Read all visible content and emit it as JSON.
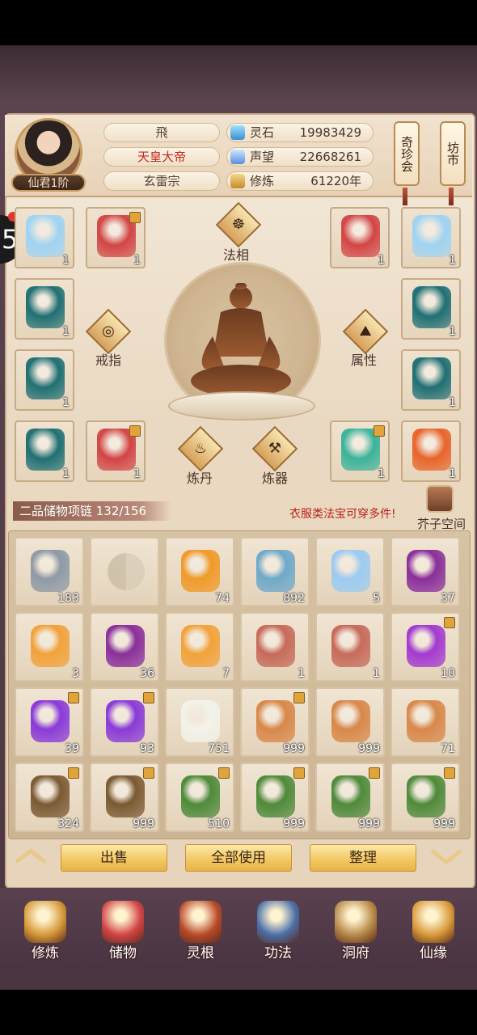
{
  "character": {
    "rank_badge": "仙君1阶",
    "name": "飛",
    "title": "天皇大帝",
    "sect": "玄雷宗"
  },
  "stats": [
    {
      "label": "灵石",
      "value": "19983429",
      "icon": "spirit-stone-icon"
    },
    {
      "label": "声望",
      "value": "22668261",
      "icon": "prestige-crystal-icon"
    },
    {
      "label": "修炼",
      "value": "61220年",
      "icon": "cultivation-icon"
    }
  ],
  "side_buttons": {
    "treasure_fair": "奇珍会",
    "market": "坊市"
  },
  "edge_badge": "5",
  "equipment": {
    "slots": [
      {
        "icon": "dragon-armor-icon",
        "count": "1",
        "locked": false,
        "color": "#9fd3f2"
      },
      {
        "icon": "red-robe-icon",
        "count": "1",
        "locked": true,
        "color": "#d24545"
      },
      {
        "icon": "red-robe-icon",
        "count": "1",
        "locked": false,
        "color": "#d24545"
      },
      {
        "icon": "dragon-armor-icon",
        "count": "1",
        "locked": false,
        "color": "#9fd3f2"
      },
      {
        "icon": "teal-robe-icon",
        "count": "1",
        "locked": false,
        "color": "#1f6f73"
      },
      {
        "icon": "teal-robe-icon",
        "count": "1",
        "locked": false,
        "color": "#1f6f73"
      },
      {
        "icon": "teal-robe-icon",
        "count": "1",
        "locked": false,
        "color": "#1f6f73"
      },
      {
        "icon": "teal-robe-icon",
        "count": "1",
        "locked": false,
        "color": "#1f6f73"
      },
      {
        "icon": "teal-robe-icon",
        "count": "1",
        "locked": false,
        "color": "#1f6f73"
      },
      {
        "icon": "red-robe-icon",
        "count": "1",
        "locked": true,
        "color": "#d24545"
      },
      {
        "icon": "jade-armor-icon",
        "count": "1",
        "locked": true,
        "color": "#3bb39a"
      },
      {
        "icon": "flame-armor-icon",
        "count": "1",
        "locked": false,
        "color": "#e8642a"
      }
    ],
    "labels": {
      "dharma_form": "法相",
      "ring": "戒指",
      "attribute": "属性",
      "alchemy": "炼丹",
      "forging": "炼器"
    }
  },
  "inventory": {
    "banner": "二品储物项链 132/156",
    "hint": "衣服类法宝可穿多件!",
    "space_label": "芥子空间",
    "items": [
      {
        "icon": "silver-ore-icon",
        "count": "183",
        "locked": false,
        "color": "#8f9aa6"
      },
      {
        "icon": "empty-taiji-icon",
        "count": "",
        "locked": false,
        "color": ""
      },
      {
        "icon": "gold-ingot-icon",
        "count": "74",
        "locked": false,
        "color": "#f09a2a"
      },
      {
        "icon": "blue-orb-icon",
        "count": "892",
        "locked": false,
        "color": "#6fa9c8"
      },
      {
        "icon": "ice-orb-icon",
        "count": "5",
        "locked": false,
        "color": "#9ccbf0"
      },
      {
        "icon": "purple-flame-icon",
        "count": "37",
        "locked": false,
        "color": "#8a2f9a"
      },
      {
        "icon": "orange-flame-icon",
        "count": "3",
        "locked": false,
        "color": "#f2a23a"
      },
      {
        "icon": "purple-flame-icon",
        "count": "36",
        "locked": false,
        "color": "#8a2f9a"
      },
      {
        "icon": "orange-flame-icon",
        "count": "7",
        "locked": false,
        "color": "#f2a23a"
      },
      {
        "icon": "treasure-box-icon",
        "count": "1",
        "locked": false,
        "color": "#c76a5a"
      },
      {
        "icon": "treasure-box-icon",
        "count": "1",
        "locked": false,
        "color": "#c76a5a"
      },
      {
        "icon": "purple-pearl-icon",
        "count": "10",
        "locked": true,
        "color": "#a43ad0"
      },
      {
        "icon": "crystal-ball-icon",
        "count": "39",
        "locked": true,
        "color": "#8a3ad8"
      },
      {
        "icon": "crystal-ball-icon",
        "count": "93",
        "locked": true,
        "color": "#8a3ad8"
      },
      {
        "icon": "white-lily-icon",
        "count": "751",
        "locked": false,
        "color": "#f3f3ea"
      },
      {
        "icon": "ginseng-icon",
        "count": "999",
        "locked": true,
        "color": "#d8884a"
      },
      {
        "icon": "ginseng-icon",
        "count": "999",
        "locked": false,
        "color": "#d8884a"
      },
      {
        "icon": "ginseng-icon",
        "count": "71",
        "locked": false,
        "color": "#d8884a"
      },
      {
        "icon": "root-herb-icon",
        "count": "324",
        "locked": true,
        "color": "#7a5a32"
      },
      {
        "icon": "root-herb-icon",
        "count": "999",
        "locked": true,
        "color": "#7a5a32"
      },
      {
        "icon": "flower-herb-icon",
        "count": "510",
        "locked": true,
        "color": "#4f8a3a"
      },
      {
        "icon": "flower-herb-icon",
        "count": "999",
        "locked": true,
        "color": "#4f8a3a"
      },
      {
        "icon": "flower-herb-icon",
        "count": "999",
        "locked": true,
        "color": "#4f8a3a"
      },
      {
        "icon": "flower-herb-icon",
        "count": "999",
        "locked": true,
        "color": "#4f8a3a"
      }
    ]
  },
  "actions": {
    "sell": "出售",
    "use_all": "全部使用",
    "organize": "整理"
  },
  "nav": [
    {
      "label": "修炼",
      "icon": "cultivation-nav-icon",
      "color": "#d69a3a"
    },
    {
      "label": "储物",
      "icon": "storage-bag-icon",
      "color": "#d24545"
    },
    {
      "label": "灵根",
      "icon": "spirit-root-icon",
      "color": "#b84a2a"
    },
    {
      "label": "功法",
      "icon": "technique-book-icon",
      "color": "#4a6fa8"
    },
    {
      "label": "洞府",
      "icon": "cave-mansion-icon",
      "color": "#b88a4a"
    },
    {
      "label": "仙缘",
      "icon": "immortal-fate-icon",
      "color": "#d89a3a"
    }
  ]
}
